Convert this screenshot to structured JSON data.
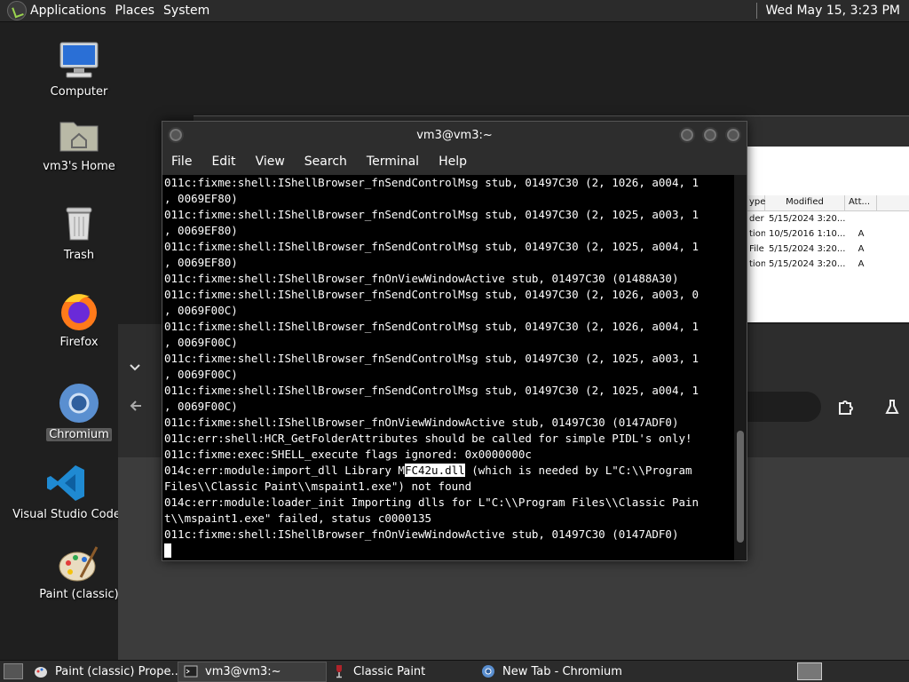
{
  "top_panel": {
    "menus": [
      "Applications",
      "Places",
      "System"
    ],
    "clock": "Wed May 15,  3:23 PM"
  },
  "desktop": {
    "icons": [
      {
        "label": "Computer",
        "icon": "computer-icon"
      },
      {
        "label": "vm3's Home",
        "icon": "home-folder-icon"
      },
      {
        "label": "Trash",
        "icon": "trash-icon"
      },
      {
        "label": "Firefox",
        "icon": "firefox-icon"
      },
      {
        "label": "Chromium",
        "icon": "chromium-icon"
      },
      {
        "label": "Visual Studio Code",
        "icon": "vscode-icon"
      },
      {
        "label": "Paint (classic)",
        "icon": "paint-palette-icon"
      }
    ]
  },
  "explorer": {
    "columns": [
      "ype",
      "Modified",
      "Att..."
    ],
    "rows": [
      {
        "type": "der",
        "modified": "5/15/2024 3:20...",
        "attr": ""
      },
      {
        "type": "tion",
        "modified": "10/5/2016 1:10...",
        "attr": "A"
      },
      {
        "type": "File",
        "modified": "5/15/2024 3:20...",
        "attr": "A"
      },
      {
        "type": "tion",
        "modified": "5/15/2024 3:20...",
        "attr": "A"
      }
    ]
  },
  "terminal": {
    "title": "vm3@vm3:~",
    "menu": [
      "File",
      "Edit",
      "View",
      "Search",
      "Terminal",
      "Help"
    ],
    "lines": [
      "011c:fixme:shell:IShellBrowser_fnSendControlMsg stub, 01497C30 (2, 1026, a004, 1",
      ", 0069EF80)",
      "011c:fixme:shell:IShellBrowser_fnSendControlMsg stub, 01497C30 (2, 1025, a003, 1",
      ", 0069EF80)",
      "011c:fixme:shell:IShellBrowser_fnSendControlMsg stub, 01497C30 (2, 1025, a004, 1",
      ", 0069EF80)",
      "011c:fixme:shell:IShellBrowser_fnOnViewWindowActive stub, 01497C30 (01488A30)",
      "011c:fixme:shell:IShellBrowser_fnSendControlMsg stub, 01497C30 (2, 1026, a003, 0",
      ", 0069F00C)",
      "011c:fixme:shell:IShellBrowser_fnSendControlMsg stub, 01497C30 (2, 1026, a004, 1",
      ", 0069F00C)",
      "011c:fixme:shell:IShellBrowser_fnSendControlMsg stub, 01497C30 (2, 1025, a003, 1",
      ", 0069F00C)",
      "011c:fixme:shell:IShellBrowser_fnSendControlMsg stub, 01497C30 (2, 1025, a004, 1",
      ", 0069F00C)",
      "011c:fixme:shell:IShellBrowser_fnOnViewWindowActive stub, 01497C30 (0147ADF0)",
      "011c:err:shell:HCR_GetFolderAttributes should be called for simple PIDL's only!",
      "011c:fixme:exec:SHELL_execute flags ignored: 0x0000000c"
    ],
    "sel_line": {
      "before": "014c:err:module:import_dll Library M",
      "selected": "FC42u.dll",
      "after": " (which is needed by L\"C:\\\\Program"
    },
    "lines2": [
      "Files\\\\Classic Paint\\\\mspaint1.exe\") not found",
      "014c:err:module:loader_init Importing dlls for L\"C:\\\\Program Files\\\\Classic Pain",
      "t\\\\mspaint1.exe\" failed, status c0000135",
      "011c:fixme:shell:IShellBrowser_fnOnViewWindowActive stub, 01497C30 (0147ADF0)"
    ]
  },
  "taskbar": {
    "tasks": [
      {
        "label": "Paint (classic) Prope...",
        "icon": "paint-properties-icon",
        "active": false
      },
      {
        "label": "vm3@vm3:~",
        "icon": "terminal-icon",
        "active": true
      },
      {
        "label": "Classic Paint",
        "icon": "wine-glass-icon",
        "active": false
      },
      {
        "label": "New Tab - Chromium",
        "icon": "chromium-icon",
        "active": false
      }
    ]
  }
}
